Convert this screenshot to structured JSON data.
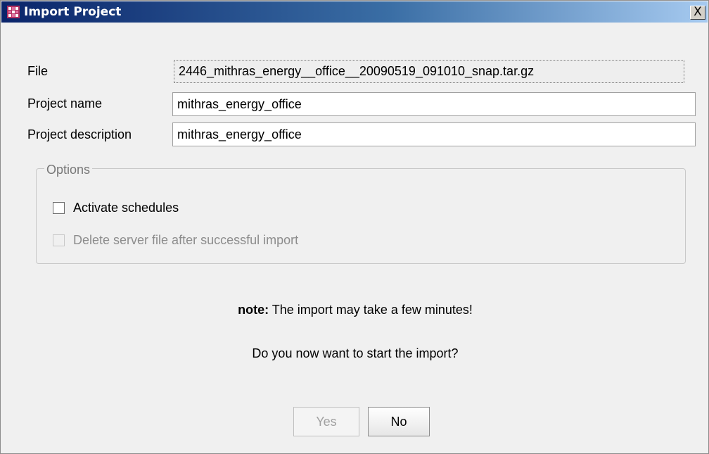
{
  "window": {
    "title": "Import Project",
    "close_label": "X"
  },
  "form": {
    "file_label": "File",
    "file_value": "2446_mithras_energy__office__20090519_091010_snap.tar.gz",
    "project_name_label": "Project name",
    "project_name_value": "mithras_energy_office",
    "project_description_label": "Project description",
    "project_description_value": "mithras_energy_office"
  },
  "options": {
    "legend": "Options",
    "activate_schedules": {
      "label": "Activate schedules",
      "checked": false,
      "enabled": true
    },
    "delete_server_file": {
      "label": "Delete server file after successful import",
      "checked": false,
      "enabled": false
    }
  },
  "messages": {
    "note_prefix": "note:",
    "note_text": " The import may take a few minutes!",
    "question": "Do you now want to start the import?"
  },
  "buttons": {
    "yes_label": "Yes",
    "yes_enabled": false,
    "no_label": "No"
  },
  "colors": {
    "titlebar_start": "#0a246a",
    "titlebar_end": "#a6caf0",
    "dialog_background": "#f0f0f0",
    "disabled_text": "#8c8c8c"
  },
  "icons": {
    "app_icon": "app-icon",
    "close_icon": "close-icon"
  }
}
